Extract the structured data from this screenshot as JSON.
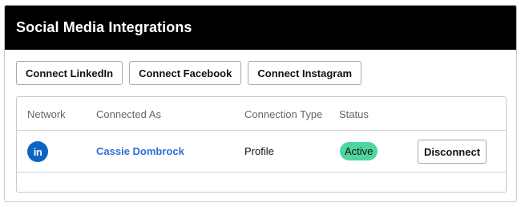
{
  "panel": {
    "title": "Social Media Integrations"
  },
  "connect_buttons": [
    {
      "label": "Connect LinkedIn"
    },
    {
      "label": "Connect Facebook"
    },
    {
      "label": "Connect Instagram"
    }
  ],
  "table": {
    "columns": [
      "Network",
      "Connected As",
      "Connection Type",
      "Status"
    ],
    "rows": [
      {
        "network_icon": "linkedin-icon",
        "network_icon_text": "in",
        "connected_as": "Cassie Dombrock",
        "connection_type": "Profile",
        "status": "Active",
        "action": "Disconnect"
      }
    ]
  },
  "colors": {
    "header_bg": "#000000",
    "link": "#2f6fd8",
    "status_active": "#4fd6a0",
    "linkedin": "#0a66c2"
  }
}
